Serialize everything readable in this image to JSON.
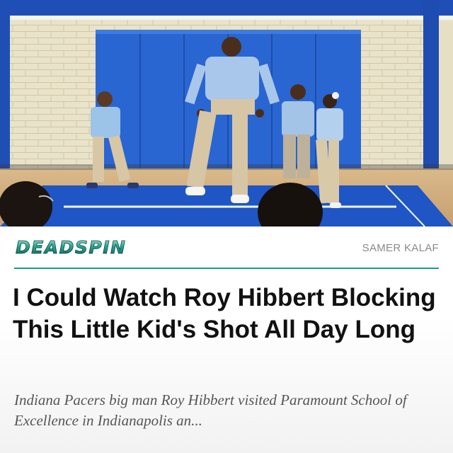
{
  "article": {
    "brand": "DEADSPIN",
    "author": "SAMER KALAF",
    "headline": "I Could Watch Roy Hibbert Blocking This Little Kid's Shot All Day Long",
    "dek": "Indiana Pacers big man Roy Hibbert visited Paramount School of Excellence in Indianapolis an..."
  },
  "colors": {
    "accent": "#1f9a8c",
    "headline": "#111111",
    "byline": "#8a8a8a",
    "dek": "#555555"
  }
}
